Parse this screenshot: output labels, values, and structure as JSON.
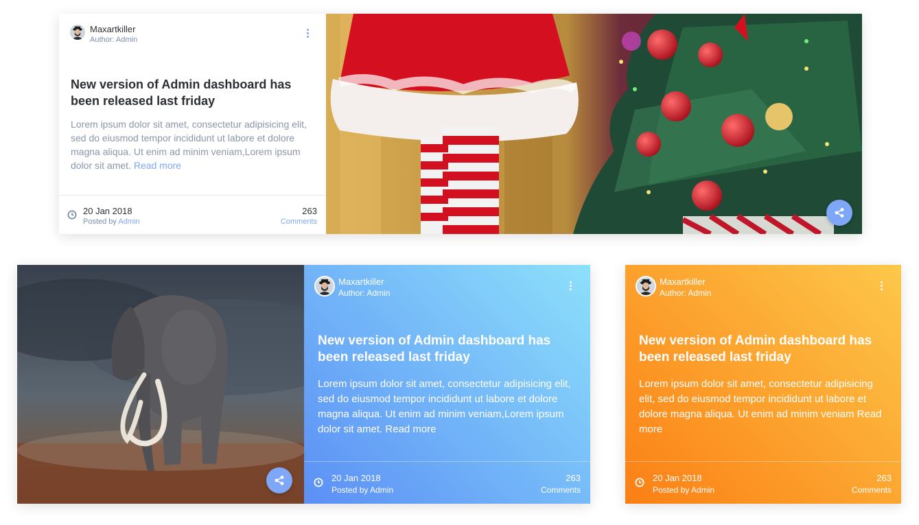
{
  "cards": [
    {
      "author": {
        "name": "Maxartkiller",
        "role": "Author: Admin"
      },
      "title": "New version of Admin dashboard has been released last friday",
      "body": "Lorem ipsum dolor sit amet, consectetur adipisicing elit, sed do eiusmod tempor incididunt ut labore et dolore magna aliqua. Ut enim ad minim veniam,Lorem ipsum dolor sit amet.",
      "read_more": "Read more",
      "date": "20 Jan 2018",
      "posted_by_prefix": "Posted by",
      "posted_by_link": "Admin",
      "comment_count": "263",
      "comment_label": "Comments",
      "image": "christmas-tree-photo",
      "share_icon": "share-icon"
    },
    {
      "author": {
        "name": "Maxartkiller",
        "role": "Author: Admin"
      },
      "title": "New version of Admin dashboard has been released last friday",
      "body": "Lorem ipsum dolor sit amet, consectetur adipisicing elit, sed do eiusmod tempor incididunt ut labore et dolore magna aliqua. Ut enim ad minim veniam,Lorem ipsum dolor sit amet.",
      "read_more": "Read more",
      "date": "20 Jan 2018",
      "posted_by": "Posted by Admin",
      "comment_count": "263",
      "comment_label": "Comments",
      "image": "elephant-photo",
      "share_icon": "share-icon",
      "gradient": [
        "#5b8ff5",
        "#8de0fb"
      ]
    },
    {
      "author": {
        "name": "Maxartkiller",
        "role": "Author: Admin"
      },
      "title": "New version of Admin dashboard has been released last friday",
      "body": "Lorem ipsum dolor sit amet, consectetur adipisicing elit, sed do eiusmod tempor incididunt ut labore et dolore magna aliqua. Ut enim ad minim veniam",
      "read_more": "Read more",
      "date": "20 Jan 2018",
      "posted_by": "Posted by Admin",
      "comment_count": "263",
      "comment_label": "Comments",
      "gradient": [
        "#fb7f14",
        "#fdc84a"
      ]
    }
  ],
  "colors": {
    "accent": "#7ea7f7",
    "title_dark": "#2b2f33",
    "body_muted": "#8a96a8",
    "link": "#7ea7f7"
  }
}
